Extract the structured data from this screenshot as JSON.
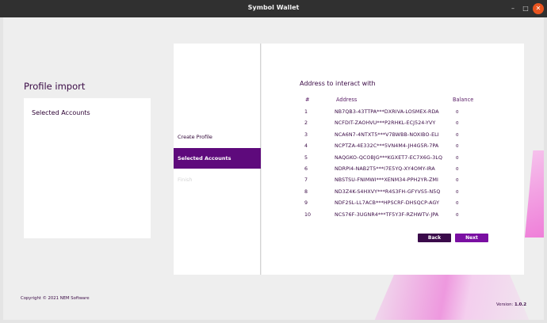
{
  "window": {
    "title": "Symbol Wallet",
    "min": "–",
    "max": "□",
    "close": "✕"
  },
  "sidebar": {
    "page_title": "Profile import",
    "selected_header": "Selected Accounts"
  },
  "steps": [
    {
      "label": "Create Profile",
      "state": "done"
    },
    {
      "label": "Selected Accounts",
      "state": "active"
    },
    {
      "label": "Finish",
      "state": "disabled"
    }
  ],
  "main": {
    "heading": "Address to interact with",
    "columns": {
      "num": "#",
      "address": "Address",
      "balance": "Balance"
    },
    "rows": [
      {
        "n": "1",
        "address": "NB7QB3-43TTPA***DXRIVA-LOSMEX-RDA",
        "balance": "0"
      },
      {
        "n": "2",
        "address": "NCFDIT-ZAOHVU***P2RHKL-ECJ524-YVY",
        "balance": "0"
      },
      {
        "n": "3",
        "address": "NCA6N7-4NTXT5***V7BWBB-NOXIBO-ELI",
        "balance": "0"
      },
      {
        "n": "4",
        "address": "NCPTZA-4E332C***5VN4M4-JH4G5R-7PA",
        "balance": "0"
      },
      {
        "n": "5",
        "address": "NAQGKO-QCOBJG***KGXET7-EC7X6G-3LQ",
        "balance": "0"
      },
      {
        "n": "6",
        "address": "NDRPI4-NAB2T5***I7E5YQ-XY4OMY-IRA",
        "balance": "0"
      },
      {
        "n": "7",
        "address": "NBSTSU-FNIMWI***XENM34-PPH2YR-ZMI",
        "balance": "0"
      },
      {
        "n": "8",
        "address": "ND3Z4K-S4HXVY***R4S3FH-GFYVS5-N5Q",
        "balance": "0"
      },
      {
        "n": "9",
        "address": "NDF2SL-LL7ACB***HPSCRF-DHSQCP-AGY",
        "balance": "0"
      },
      {
        "n": "10",
        "address": "NCS76F-3UGNR4***TF5Y3F-RZHWTV-JPA",
        "balance": "0"
      }
    ],
    "back_label": "Back",
    "next_label": "Next"
  },
  "footer": {
    "copyright": "Copyright © 2021 NEM Software",
    "version_label": "Version:",
    "version": "1.0.2"
  },
  "colors": {
    "accent": "#5e0a7c",
    "next": "#7a0fa2",
    "back": "#3a0a4a",
    "titlebar": "#303030",
    "close": "#e9541f"
  }
}
